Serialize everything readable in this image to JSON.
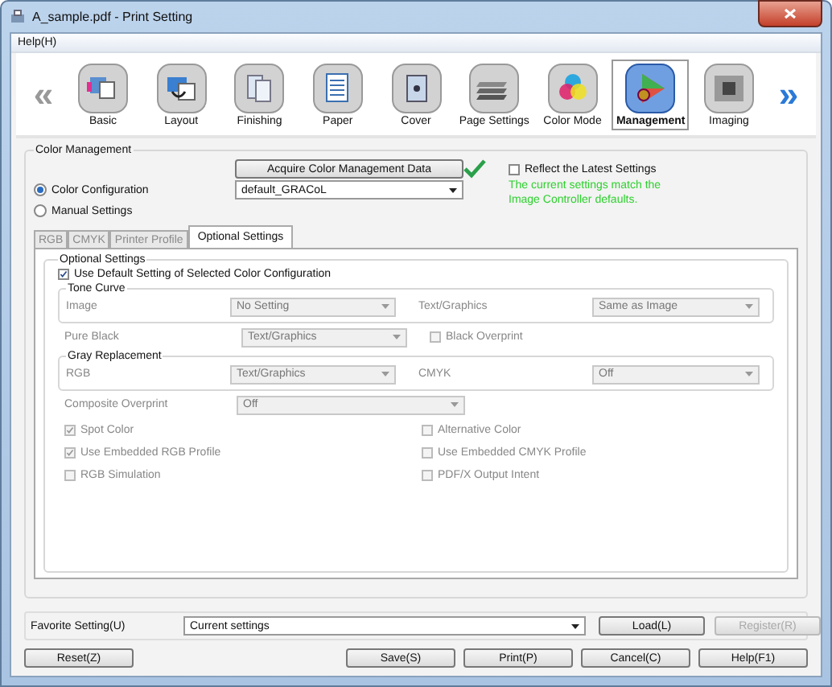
{
  "window": {
    "title": "A_sample.pdf - Print Setting"
  },
  "menu": [
    "Help(H)"
  ],
  "toolbar": {
    "scroll_left": "«",
    "scroll_right": "»",
    "items": [
      {
        "label": "Basic",
        "selected": false
      },
      {
        "label": "Layout",
        "selected": false
      },
      {
        "label": "Finishing",
        "selected": false
      },
      {
        "label": "Paper",
        "selected": false
      },
      {
        "label": "Cover",
        "selected": false
      },
      {
        "label": "Page Settings",
        "selected": false
      },
      {
        "label": "Color Mode",
        "selected": false
      },
      {
        "label": "Management",
        "selected": true
      },
      {
        "label": "Imaging",
        "selected": false
      }
    ]
  },
  "color_management": {
    "title": "Color Management",
    "acquire_button": "Acquire Color Management Data",
    "reflect_latest": {
      "label": "Reflect the Latest Settings",
      "checked": false
    },
    "status_message": "The current settings match the Image Controller defaults.",
    "modes": [
      {
        "label": "Color Configuration",
        "selected": true
      },
      {
        "label": "Manual Settings",
        "selected": false
      }
    ],
    "configuration": "default_GRACoL",
    "tabs": [
      {
        "label": "RGB",
        "selected": false,
        "disabled": true
      },
      {
        "label": "CMYK",
        "selected": false,
        "disabled": true
      },
      {
        "label": "Printer Profile",
        "selected": false,
        "disabled": true
      },
      {
        "label": "Optional Settings",
        "selected": true,
        "disabled": false
      }
    ],
    "optional": {
      "title": "Optional Settings",
      "use_default": {
        "label": "Use Default Setting of Selected Color Configuration",
        "checked": true
      },
      "controls_disabled": true,
      "tone_curve": {
        "title": "Tone Curve",
        "fields": [
          {
            "label": "Image",
            "value": "No Setting"
          },
          {
            "label": "Text/Graphics",
            "value": "Same as Image"
          }
        ]
      },
      "pure_black": {
        "label": "Pure Black",
        "value": "Text/Graphics"
      },
      "black_overprint": {
        "label": "Black Overprint",
        "checked": false
      },
      "gray_replacement": {
        "title": "Gray Replacement",
        "fields": [
          {
            "label": "RGB",
            "value": "Text/Graphics"
          },
          {
            "label": "CMYK",
            "value": "Off"
          }
        ]
      },
      "composite_overprint": {
        "label": "Composite Overprint",
        "value": "Off"
      },
      "checkboxes": [
        {
          "label": "Spot Color",
          "checked": true
        },
        {
          "label": "Alternative Color",
          "checked": false
        },
        {
          "label": "Use Embedded RGB Profile",
          "checked": true
        },
        {
          "label": "Use Embedded CMYK Profile",
          "checked": false
        },
        {
          "label": "RGB Simulation",
          "checked": false
        },
        {
          "label": "PDF/X Output Intent",
          "checked": false
        }
      ]
    }
  },
  "favorite": {
    "label": "Favorite Setting(U)",
    "value": "Current settings",
    "buttons": [
      {
        "label": "Load(L)",
        "disabled": false
      },
      {
        "label": "Register(R)",
        "disabled": true
      }
    ]
  },
  "footer": {
    "left_buttons": [
      "Reset(Z)"
    ],
    "right_buttons": [
      "Save(S)",
      "Print(P)",
      "Cancel(C)",
      "Help(F1)"
    ]
  }
}
